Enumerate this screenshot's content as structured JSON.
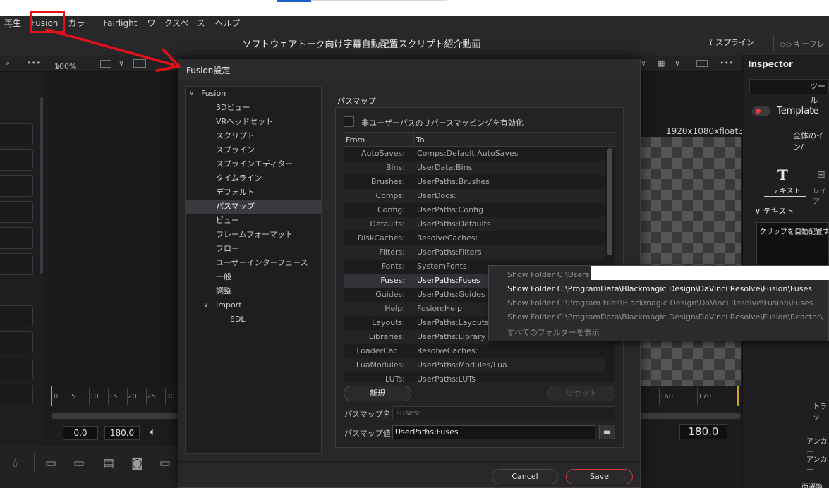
{
  "menu": {
    "items": [
      "再生",
      "Fusion",
      "カラー",
      "Fairlight",
      "ワークスペース",
      "ヘルプ"
    ]
  },
  "title_bar": {
    "project_title": "ソフトウェアトーク向け字幕自動配置スクリプト紹介動画",
    "spline_tab": "スプライン",
    "keyframe_tab": "キーフレ"
  },
  "viewer_toolbar": {
    "zoom": "100%",
    "chevron": "∨",
    "more": "•••"
  },
  "viewer": {
    "resolution_label": "1920x1080xfloat32"
  },
  "timeline": {
    "ruler_ticks": [
      "0",
      "5",
      "10",
      "15",
      "20",
      "25",
      "30",
      "160",
      "170"
    ],
    "start_time": "0.0",
    "end_time": "180.0",
    "current_time": "180.0"
  },
  "inspector": {
    "title": "Inspector",
    "tool_label": "ツール",
    "template_label": "Template",
    "global_label": "全体のイン/",
    "tab_text": "テキスト",
    "tab_layout": "レイア",
    "section_text": "テキスト",
    "text_value": "クリップを自動配置す",
    "label_tracking": "トラッ",
    "label_anchor1": "アンカー",
    "label_anchor2": "アンカー",
    "label_bottom": "面遷換"
  },
  "dialog": {
    "title": "Fusion設定",
    "tree": {
      "root": "Fusion",
      "items": [
        "3Dビュー",
        "VRヘッドセット",
        "スクリプト",
        "スプライン",
        "スプラインエディター",
        "タイムライン",
        "デフォルト",
        "パスマップ",
        "ビュー",
        "フレームフォーマット",
        "フロー",
        "ユーザーインターフェース",
        "一般",
        "調整"
      ],
      "selected": "パスマップ",
      "import_group": "Import",
      "import_items": [
        "EDL"
      ]
    },
    "pane_title": "パスマップ",
    "reverse_mapping_label": "非ユーザーパスのリバースマッピングを有効化",
    "table": {
      "headers": [
        "From",
        "To"
      ],
      "rows": [
        {
          "from": "AutoSaves:",
          "to": "Comps:Default AutoSaves"
        },
        {
          "from": "Bins:",
          "to": "UserData:Bins"
        },
        {
          "from": "Brushes:",
          "to": "UserPaths:Brushes"
        },
        {
          "from": "Comps:",
          "to": "UserDocs:"
        },
        {
          "from": "Config:",
          "to": "UserPaths:Config"
        },
        {
          "from": "Defaults:",
          "to": "UserPaths:Defaults"
        },
        {
          "from": "DiskCaches:",
          "to": "ResolveCaches:"
        },
        {
          "from": "Filters:",
          "to": "UserPaths:Filters"
        },
        {
          "from": "Fonts:",
          "to": "SystemFonts:"
        },
        {
          "from": "Fuses:",
          "to": "UserPaths:Fuses"
        },
        {
          "from": "Guides:",
          "to": "UserPaths:Guides"
        },
        {
          "from": "Help:",
          "to": "Fusion:Help"
        },
        {
          "from": "Layouts:",
          "to": "UserPaths:Layouts"
        },
        {
          "from": "Libraries:",
          "to": "UserPaths:Library"
        },
        {
          "from": "LoaderCac...",
          "to": "ResolveCaches:"
        },
        {
          "from": "LuaModules:",
          "to": "UserPaths:Modules/Lua"
        },
        {
          "from": "LUTs:",
          "to": "UserPaths:LUTs"
        }
      ],
      "selected_index": 9
    },
    "new_button": "新規",
    "reset_button": "リセット",
    "name_label": "パスマップ名：",
    "name_value": "Fuses:",
    "value_label": "パスマップ値：",
    "value_value": "UserPaths:Fuses",
    "cancel_button": "Cancel",
    "save_button": "Save"
  },
  "context_menu": {
    "items": [
      {
        "label": "Show Folder C:\\Users",
        "active": false
      },
      {
        "label": "Show Folder C:\\ProgramData\\Blackmagic Design\\DaVinci Resolve\\Fusion\\Fuses",
        "active": true
      },
      {
        "label": "Show Folder C:\\Program Files\\Blackmagic Design\\DaVinci Resolve\\Fusion\\Fuses",
        "active": false
      },
      {
        "label": "Show Folder C:\\ProgramData\\Blackmagic Design\\DaVinci Resolve\\Fusion\\Reactor\\",
        "active": false
      },
      {
        "label": "すべてのフォルダーを表示",
        "active": false
      }
    ]
  },
  "colors": {
    "annotation_red": "#e5101a",
    "accent_red": "#e43a3a",
    "timeline_marker": "#d3a020"
  },
  "icons": [
    "search-icon",
    "more-icon",
    "volume-icon",
    "folder-icon",
    "spline-icon",
    "keyframe-icon",
    "text-tool-icon"
  ]
}
